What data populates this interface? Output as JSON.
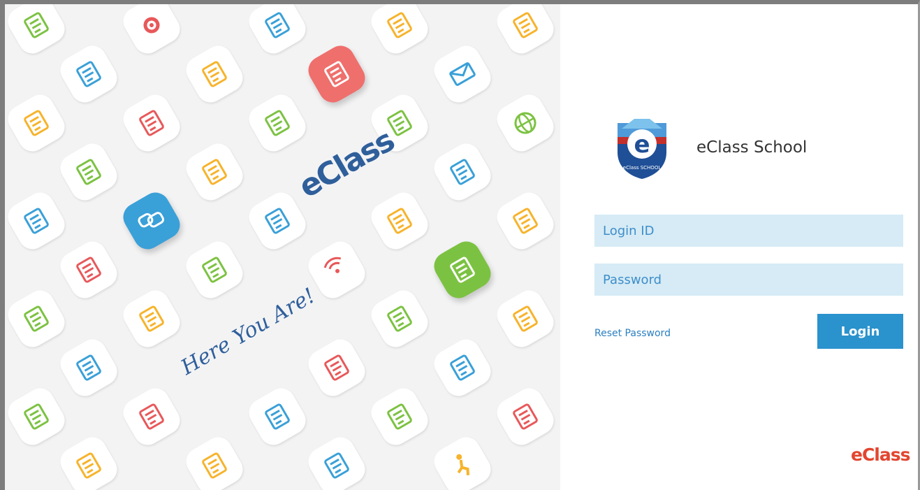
{
  "branding": {
    "hero_logo_text": "eClass",
    "hero_tagline": "Here You Are!",
    "school_name": "eClass School",
    "school_badge_letter": "e",
    "school_badge_text": "eClass SCHOOL",
    "footer_logo_text": "eClass"
  },
  "login_form": {
    "login_id": {
      "value": "",
      "placeholder": "Login ID"
    },
    "password": {
      "value": "",
      "placeholder": "Password"
    },
    "reset_password_label": "Reset Password",
    "login_button_label": "Login"
  },
  "colors": {
    "accent_blue": "#2a92cc",
    "input_bg": "#d6ebf5",
    "hero_text": "#2f5f9b",
    "footer_logo": "#e2462f"
  },
  "hero_tiles": [
    {
      "icon": "plant-icon",
      "color": "#7cc242",
      "filled": false
    },
    {
      "icon": "gear-icon",
      "color": "#e8585a",
      "filled": false
    },
    {
      "icon": "shopping-cart-icon",
      "color": "#3aa0d8",
      "filled": false
    },
    {
      "icon": "certificate-icon",
      "color": "#f7b32b",
      "filled": false
    },
    {
      "icon": "chart-document-icon",
      "color": "#f7b32b",
      "filled": false
    },
    {
      "icon": "id-card-icon",
      "color": "#3aa0d8",
      "filled": false
    },
    {
      "icon": "calendar-grid-icon",
      "color": "#f7b32b",
      "filled": false
    },
    {
      "icon": "tablet-edit-icon",
      "color": "#ffffff",
      "filled": true,
      "fill": "#ef6f6c"
    },
    {
      "icon": "mail-icon",
      "color": "#3aa0d8",
      "filled": false
    },
    {
      "icon": "profile-folder-icon",
      "color": "#f7b32b",
      "filled": false
    },
    {
      "icon": "student-reading-icon",
      "color": "#e8585a",
      "filled": false
    },
    {
      "icon": "calendar-check-icon",
      "color": "#7cc242",
      "filled": false
    },
    {
      "icon": "contact-folder-icon",
      "color": "#7cc242",
      "filled": false
    },
    {
      "icon": "globe-icon",
      "color": "#7cc242",
      "filled": false
    },
    {
      "icon": "trolley-icon",
      "color": "#7cc242",
      "filled": false
    },
    {
      "icon": "smile-calendar-icon",
      "color": "#f7b32b",
      "filled": false
    },
    {
      "icon": "badge-icon",
      "color": "#3aa0d8",
      "filled": false
    },
    {
      "icon": "printer-icon",
      "color": "#3aa0d8",
      "filled": false
    },
    {
      "icon": "chat-bubbles-icon",
      "color": "#ffffff",
      "filled": true,
      "fill": "#3aa0d8"
    },
    {
      "icon": "document-edit-icon",
      "color": "#3aa0d8",
      "filled": false
    },
    {
      "icon": "video-icon",
      "color": "#f7b32b",
      "filled": false
    },
    {
      "icon": "share-document-icon",
      "color": "#f7b32b",
      "filled": false
    },
    {
      "icon": "form-icon",
      "color": "#e8585a",
      "filled": false
    },
    {
      "icon": "checklist-calendar-icon",
      "color": "#7cc242",
      "filled": false
    },
    {
      "icon": "wireless-icon",
      "color": "#e8585a",
      "filled": false
    },
    {
      "icon": "report-icon",
      "color": "#ffffff",
      "filled": true,
      "fill": "#7cc242"
    },
    {
      "icon": "pie-report-icon",
      "color": "#7cc242",
      "filled": false
    },
    {
      "icon": "grade-paper-icon",
      "color": "#f7b32b",
      "filled": false
    },
    {
      "icon": "search-map-icon",
      "color": "#7cc242",
      "filled": false
    },
    {
      "icon": "wifi-doc-icon",
      "color": "#f7b32b",
      "filled": false
    },
    {
      "icon": "timetable-icon",
      "color": "#3aa0d8",
      "filled": false
    },
    {
      "icon": "contact-card-icon",
      "color": "#e8585a",
      "filled": false
    },
    {
      "icon": "quiz-icon",
      "color": "#3aa0d8",
      "filled": false
    },
    {
      "icon": "shield-doc-icon",
      "color": "#7cc242",
      "filled": false
    },
    {
      "icon": "book-icon",
      "color": "#e8585a",
      "filled": false
    },
    {
      "icon": "folder-icon",
      "color": "#3aa0d8",
      "filled": false
    },
    {
      "icon": "stack-papers-icon",
      "color": "#7cc242",
      "filled": false
    },
    {
      "icon": "microscope-icon",
      "color": "#e8585a",
      "filled": false
    },
    {
      "icon": "printer-paper-icon",
      "color": "#f7b32b",
      "filled": false
    },
    {
      "icon": "notes-icon",
      "color": "#f7b32b",
      "filled": false
    },
    {
      "icon": "message-tablet-icon",
      "color": "#3aa0d8",
      "filled": false
    },
    {
      "icon": "running-person-icon",
      "color": "#f7b32b",
      "filled": false
    }
  ]
}
